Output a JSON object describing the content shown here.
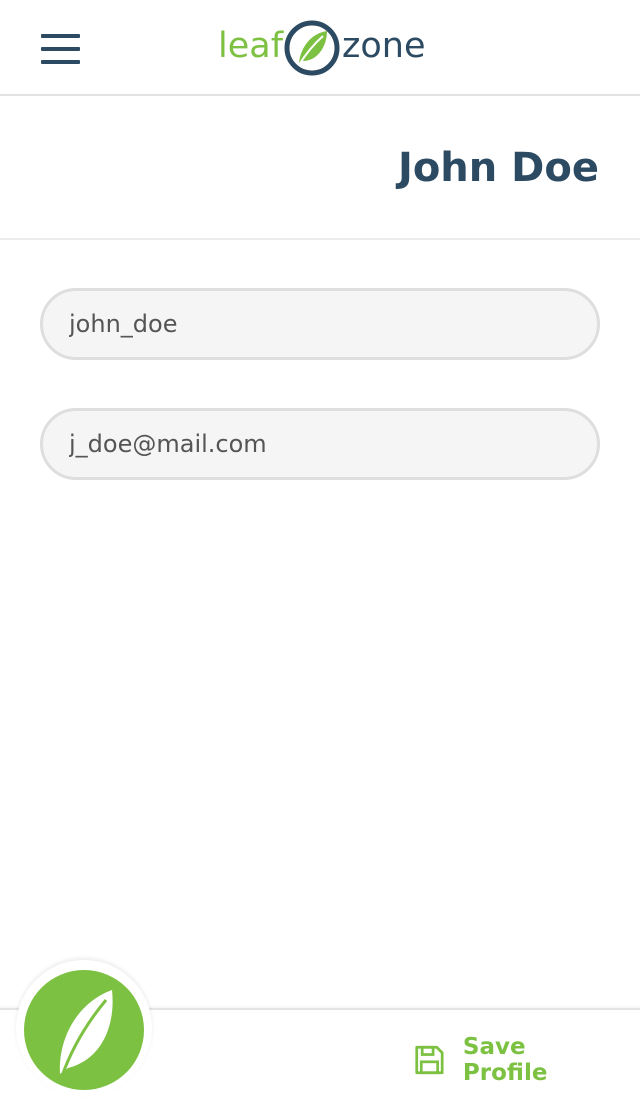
{
  "header": {
    "menu_icon": "hamburger-menu-icon",
    "logo": {
      "left_text": "leaf",
      "right_text": "zone"
    }
  },
  "profile": {
    "title": "John Doe",
    "username_value": "john_doe",
    "email_value": "j_doe@mail.com"
  },
  "footer": {
    "fab_icon": "leaf-icon",
    "save_icon": "floppy-disk-icon",
    "save_label": "Save Profile"
  },
  "colors": {
    "brand_green": "#7dc142",
    "brand_navy": "#2c4a62",
    "field_bg": "#f5f5f5",
    "field_border": "#dedede"
  }
}
